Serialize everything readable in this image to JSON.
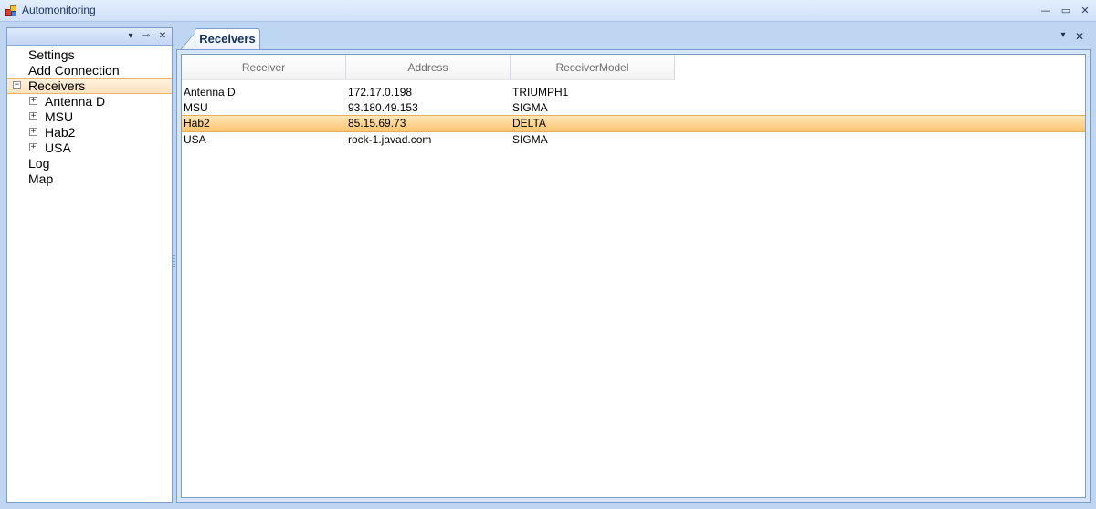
{
  "window": {
    "title": "Automonitoring",
    "minimize": "—",
    "maximize": "▭",
    "close": "✕"
  },
  "left_panel": {
    "buttons": {
      "dropdown": "▾",
      "pin": "⊸",
      "close": "✕"
    },
    "tree": [
      {
        "label": "Settings",
        "level": 0,
        "expander": ""
      },
      {
        "label": "Add Connection",
        "level": 0,
        "expander": ""
      },
      {
        "label": "Receivers",
        "level": 0,
        "expander": "−",
        "selected": true
      },
      {
        "label": "Antenna D",
        "level": 1,
        "expander": "+"
      },
      {
        "label": "MSU",
        "level": 1,
        "expander": "+"
      },
      {
        "label": "Hab2",
        "level": 1,
        "expander": "+"
      },
      {
        "label": "USA",
        "level": 1,
        "expander": "+"
      },
      {
        "label": "Log",
        "level": 0,
        "expander": ""
      },
      {
        "label": "Map",
        "level": 0,
        "expander": ""
      }
    ]
  },
  "document": {
    "tab_label": "Receivers",
    "buttons": {
      "dropdown": "▾",
      "close": "✕"
    },
    "table": {
      "columns": [
        "Receiver",
        "Address",
        "ReceiverModel"
      ],
      "rows": [
        {
          "receiver": "Antenna D",
          "address": "172.17.0.198",
          "model": "TRIUMPH1"
        },
        {
          "receiver": "MSU",
          "address": "93.180.49.153",
          "model": "SIGMA"
        },
        {
          "receiver": "Hab2",
          "address": "85.15.69.73",
          "model": "DELTA",
          "selected": true
        },
        {
          "receiver": "USA",
          "address": "rock-1.javad.com",
          "model": "SIGMA"
        }
      ]
    }
  },
  "colors": {
    "selection": "#fbc46f",
    "frame_border": "#7d9ecb",
    "background": "#bfd6f2"
  }
}
